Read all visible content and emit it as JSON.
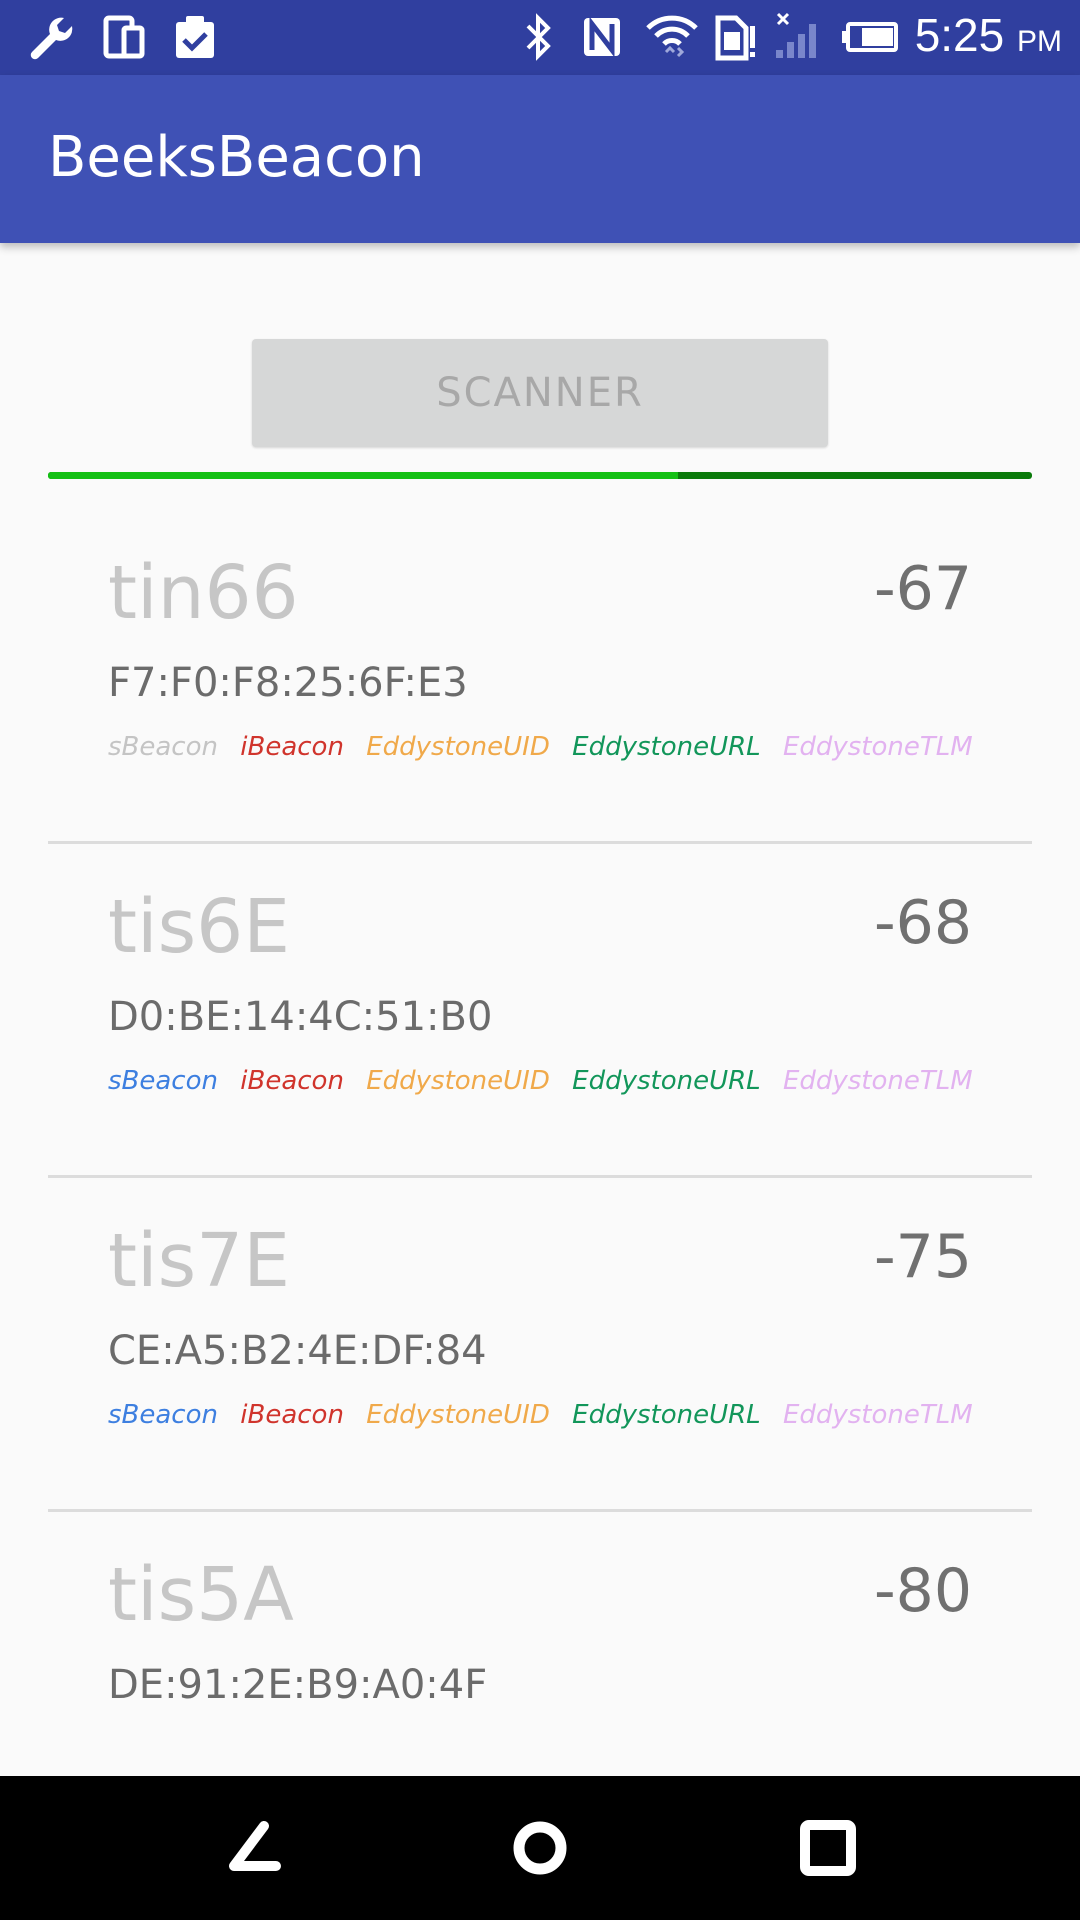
{
  "status_bar": {
    "time": "5:25",
    "ampm": "PM",
    "icons": [
      "wrench-icon",
      "devices-icon",
      "clipboard-check-icon",
      "bluetooth-icon",
      "nfc-icon",
      "wifi-icon",
      "sim-icon",
      "signal-icon",
      "battery-icon"
    ]
  },
  "app_bar": {
    "title": "BeeksBeacon"
  },
  "scanner": {
    "label": "SCANNER",
    "progress": 0.64
  },
  "colors": {
    "status_bar": "#303f9f",
    "app_bar": "#3f51b5",
    "progress": "#14c014",
    "sBeacon_active": "#3d7fe0",
    "sBeacon_inactive": "#c4c4c4",
    "iBeacon": "#d0342c",
    "EddystoneUID": "#f0a94a",
    "EddystoneURL": "#12965a",
    "EddystoneTLM": "#e2b2f0"
  },
  "beacons": [
    {
      "name": "tin66",
      "rssi": "-67",
      "mac": "F7:F0:F8:25:6F:E3",
      "tags": [
        {
          "label": "sBeacon",
          "color": "#c4c4c4"
        },
        {
          "label": "iBeacon",
          "color": "#d0342c"
        },
        {
          "label": "EddystoneUID",
          "color": "#f0a94a"
        },
        {
          "label": "EddystoneURL",
          "color": "#12965a"
        },
        {
          "label": "EddystoneTLM",
          "color": "#e2b2f0"
        }
      ]
    },
    {
      "name": "tis6E",
      "rssi": "-68",
      "mac": "D0:BE:14:4C:51:B0",
      "tags": [
        {
          "label": "sBeacon",
          "color": "#3d7fe0"
        },
        {
          "label": "iBeacon",
          "color": "#d0342c"
        },
        {
          "label": "EddystoneUID",
          "color": "#f0a94a"
        },
        {
          "label": "EddystoneURL",
          "color": "#12965a"
        },
        {
          "label": "EddystoneTLM",
          "color": "#e2b2f0"
        }
      ]
    },
    {
      "name": "tis7E",
      "rssi": "-75",
      "mac": "CE:A5:B2:4E:DF:84",
      "tags": [
        {
          "label": "sBeacon",
          "color": "#3d7fe0"
        },
        {
          "label": "iBeacon",
          "color": "#d0342c"
        },
        {
          "label": "EddystoneUID",
          "color": "#f0a94a"
        },
        {
          "label": "EddystoneURL",
          "color": "#12965a"
        },
        {
          "label": "EddystoneTLM",
          "color": "#e2b2f0"
        }
      ]
    },
    {
      "name": "tis5A",
      "rssi": "-80",
      "mac": "DE:91:2E:B9:A0:4F",
      "tags": []
    }
  ],
  "nav_bar": {
    "icons": [
      "back-icon",
      "home-icon",
      "recents-icon"
    ]
  }
}
